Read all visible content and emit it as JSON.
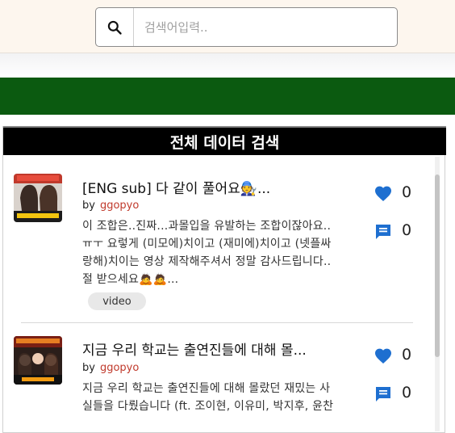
{
  "search": {
    "placeholder": "검색어입력.."
  },
  "panel": {
    "title": "전체 데이터 검색"
  },
  "items": [
    {
      "title": "[ENG sub] 다 같이 풀어요🧑‍🔧...",
      "by_label": "by",
      "author": "ggopyo",
      "desc_line1": "이 조합은..진짜...과몰입을 유발하는 조합이잖아요..",
      "desc_line2": "ㅠㅜ 요렇게 (미모에)치이고 (재미에)치이고 (넷플싸",
      "desc_line3": "랑해)치이는 영상 제작해주셔서 정말 감사드립니다..",
      "desc_line4": "절 받으세요🙇🙇...",
      "tag": "video",
      "likes": "0",
      "comments": "0"
    },
    {
      "title": "지금 우리 학교는 출연진들에 대해 몰...",
      "by_label": "by",
      "author": "ggopyo",
      "desc_line1": "지금 우리 학교는 출연진들에 대해 몰랐던 재밌는 사",
      "desc_line2": "실들을 다뤘습니다 (ft. 조이현, 이유미, 박지후, 윤찬",
      "likes": "0",
      "comments": "0"
    }
  ],
  "icons": {
    "search": "search-icon",
    "like": "heart-icon",
    "comment": "comment-icon"
  },
  "colors": {
    "accent_green": "#0b5a10",
    "icon_blue": "#1e6fd0",
    "author_red": "#c0392b"
  }
}
